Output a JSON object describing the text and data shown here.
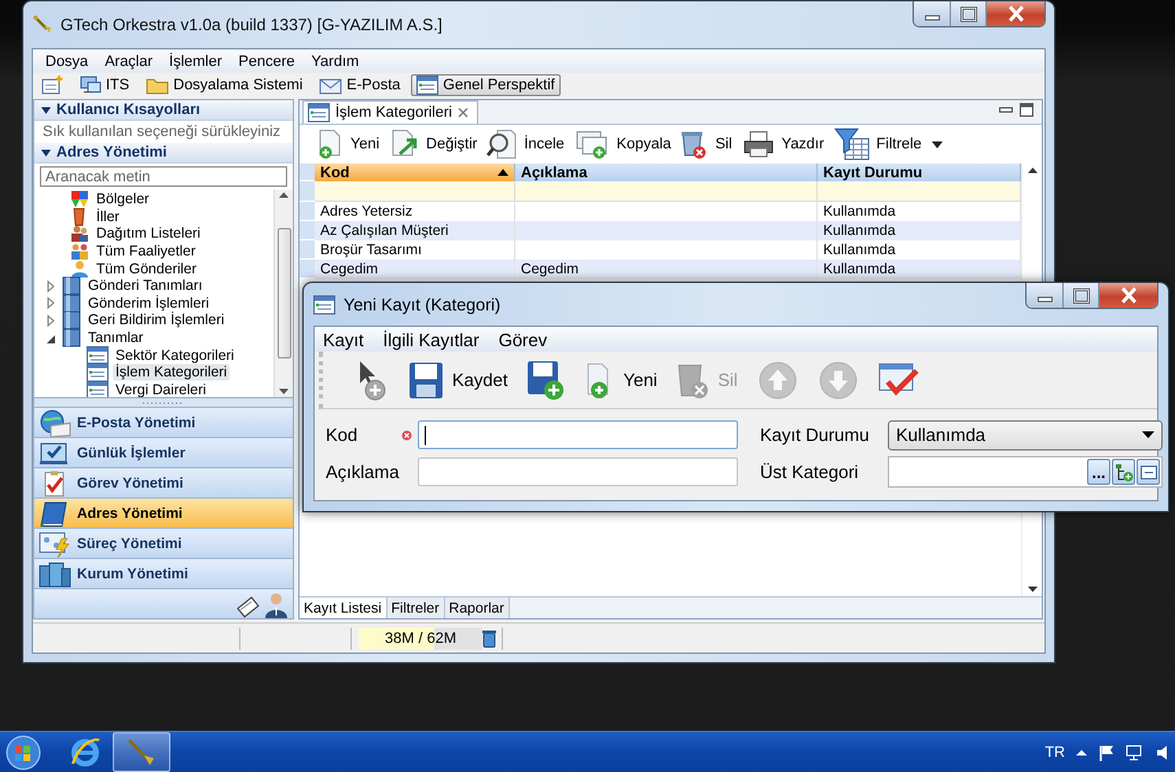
{
  "main_window": {
    "title": "GTech Orkestra v1.0a (build 1337) [G-YAZILIM A.S.]",
    "menu": [
      "Dosya",
      "Araçlar",
      "İşlemler",
      "Pencere",
      "Yardım"
    ],
    "perspectives": [
      {
        "label": "ITS",
        "selected": false
      },
      {
        "label": "Dosyalama Sistemi",
        "selected": false
      },
      {
        "label": "E-Posta",
        "selected": false
      },
      {
        "label": "Genel Perspektif",
        "selected": true
      }
    ],
    "left_panel": {
      "shortcuts": {
        "title": "Kullanıcı Kısayolları",
        "hint": "Sık kullanılan seçeneği sürükleyiniz"
      },
      "address": {
        "title": "Adres Yönetimi",
        "search_placeholder": "Aranacak metin",
        "tree": [
          {
            "kind": "leaf",
            "label": "Bölgeler",
            "selected": false
          },
          {
            "kind": "leaf",
            "label": "İller",
            "selected": false
          },
          {
            "kind": "leaf",
            "label": "Dağıtım Listeleri",
            "selected": false
          },
          {
            "kind": "leaf",
            "label": "Tüm Faaliyetler",
            "selected": false
          },
          {
            "kind": "leaf",
            "label": "Tüm Gönderiler",
            "selected": false
          },
          {
            "kind": "folder",
            "label": "Gönderi Tanımları",
            "selected": false,
            "expanded": false
          },
          {
            "kind": "folder",
            "label": "Gönderim İşlemleri",
            "selected": false,
            "expanded": false
          },
          {
            "kind": "folder",
            "label": "Geri Bildirim İşlemleri",
            "selected": false,
            "expanded": false
          },
          {
            "kind": "folder",
            "label": "Tanımlar",
            "selected": false,
            "expanded": true,
            "children": [
              {
                "kind": "leaf",
                "label": "Sektör Kategorileri",
                "selected": false
              },
              {
                "kind": "leaf",
                "label": "İşlem Kategorileri",
                "selected": true
              },
              {
                "kind": "leaf",
                "label": "Vergi Daireleri",
                "selected": false
              }
            ]
          }
        ]
      },
      "nav": [
        {
          "label": "E-Posta Yönetimi",
          "selected": false
        },
        {
          "label": "Günlük İşlemler",
          "selected": false
        },
        {
          "label": "Görev Yönetimi",
          "selected": false
        },
        {
          "label": "Adres Yönetimi",
          "selected": true
        },
        {
          "label": "Süreç Yönetimi",
          "selected": false
        },
        {
          "label": "Kurum Yönetimi",
          "selected": false
        }
      ]
    },
    "editor": {
      "tab": "İşlem Kategorileri",
      "toolbar": [
        "Yeni",
        "Değiştir",
        "İncele",
        "Kopyala",
        "Sil",
        "Yazdır",
        "Filtrele"
      ],
      "columns": [
        {
          "label": "Kod",
          "sorted": true
        },
        {
          "label": "Açıklama",
          "sorted": false
        },
        {
          "label": "Kayıt Durumu",
          "sorted": false
        }
      ],
      "rows": [
        {
          "kod": "Adres Yetersiz",
          "durum": "Kullanımda"
        },
        {
          "kod": "Az Çalışılan Müşteri",
          "durum": "Kullanımda"
        },
        {
          "kod": "Broşür Tasarımı",
          "durum": "Kullanımda"
        },
        {
          "kod": "Cegedim",
          "aciklama": "Cegedim",
          "durum": "Kullanımda"
        }
      ],
      "bottom_tabs": [
        {
          "label": "Kayıt Listesi",
          "selected": true
        },
        {
          "label": "Filtreler",
          "selected": false
        },
        {
          "label": "Raporlar",
          "selected": false
        }
      ]
    },
    "status_bar": {
      "memory": "38M / 62M",
      "level": 0.61
    }
  },
  "dialog": {
    "title": "Yeni Kayıt (Kategori)",
    "menu": [
      "Kayıt",
      "İlgili Kayıtlar",
      "Görev"
    ],
    "toolbar": [
      {
        "disabled": false
      },
      {
        "label": "Kaydet",
        "disabled": false
      },
      {
        "disabled": false
      },
      {
        "label": "Yeni",
        "disabled": false
      },
      {
        "label": "Sil",
        "disabled": true
      },
      {
        "disabled": true
      },
      {
        "disabled": true
      },
      {
        "disabled": false
      }
    ],
    "fields": [
      {
        "kind": "text",
        "label": "Kod",
        "required": true,
        "focused": true
      },
      {
        "kind": "text",
        "label": "Açıklama",
        "required": false,
        "focused": false
      },
      {
        "kind": "select",
        "label": "Kayıt Durumu",
        "value": "Kullanımda"
      },
      {
        "kind": "lookup",
        "label": "Üst Kategori",
        "button_text": "..."
      }
    ]
  },
  "taskbar": {
    "language": "TR"
  }
}
